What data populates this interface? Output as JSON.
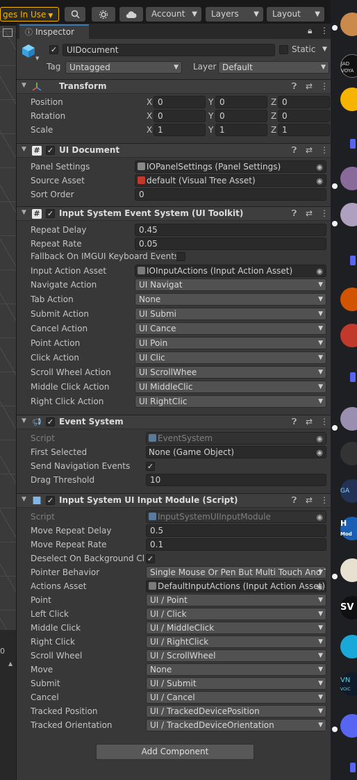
{
  "toolbar": {
    "changes_label": "ges In Use",
    "account_label": "Account",
    "layers_label": "Layers",
    "layout_label": "Layout",
    "icons": [
      "search-icon",
      "settings-gear-icon",
      "cloud-icon"
    ]
  },
  "scene": {
    "lower_label": "0"
  },
  "inspector": {
    "tab_label": "Inspector",
    "object": {
      "name": "UIDocument",
      "static_label": "Static",
      "tag_label": "Tag",
      "tag_value": "Untagged",
      "layer_label": "Layer",
      "layer_value": "Default"
    },
    "transform": {
      "title": "Transform",
      "rows": [
        {
          "label": "Position",
          "x": "0",
          "y": "0",
          "z": "0"
        },
        {
          "label": "Rotation",
          "x": "0",
          "y": "0",
          "z": "0"
        },
        {
          "label": "Scale",
          "x": "1",
          "y": "1",
          "z": "1"
        }
      ],
      "axes": [
        "X",
        "Y",
        "Z"
      ]
    },
    "ui_document": {
      "title": "UI Document",
      "panel_settings_label": "Panel Settings",
      "panel_settings_value": "IOPanelSettings (Panel Settings)",
      "source_asset_label": "Source Asset",
      "source_asset_value": "default (Visual Tree Asset)",
      "sort_order_label": "Sort Order",
      "sort_order_value": "0"
    },
    "input_event_system": {
      "title": "Input System Event System (UI Toolkit)",
      "repeat_delay_label": "Repeat Delay",
      "repeat_delay_value": "0.45",
      "repeat_rate_label": "Repeat Rate",
      "repeat_rate_value": "0.05",
      "fallback_label": "Fallback On IMGUI Keyboard Events",
      "input_action_asset_label": "Input Action Asset",
      "input_action_asset_value": "IOInputActions (Input Action Asset)",
      "actions": [
        {
          "label": "Navigate Action",
          "value": "UI Navigat"
        },
        {
          "label": "Tab Action",
          "value": "None"
        },
        {
          "label": "Submit Action",
          "value": "UI Submi"
        },
        {
          "label": "Cancel Action",
          "value": "UI Cance"
        },
        {
          "label": "Point Action",
          "value": "UI Poin"
        },
        {
          "label": "Click Action",
          "value": "UI Clic"
        },
        {
          "label": "Scroll Wheel Action",
          "value": "UI ScrollWhee"
        },
        {
          "label": "Middle Click Action",
          "value": "UI MiddleClic"
        },
        {
          "label": "Right Click Action",
          "value": "UI RightClic"
        }
      ]
    },
    "event_system": {
      "title": "Event System",
      "script_label": "Script",
      "script_value": "EventSystem",
      "first_selected_label": "First Selected",
      "first_selected_value": "None (Game Object)",
      "send_nav_label": "Send Navigation Events",
      "send_nav_checked": true,
      "drag_threshold_label": "Drag Threshold",
      "drag_threshold_value": "10"
    },
    "input_module": {
      "title": "Input System UI Input Module (Script)",
      "script_label": "Script",
      "script_value": "InputSystemUIInputModule",
      "move_repeat_delay_label": "Move Repeat Delay",
      "move_repeat_delay_value": "0.5",
      "move_repeat_rate_label": "Move Repeat Rate",
      "move_repeat_rate_value": "0.1",
      "deselect_label": "Deselect On Background Clic",
      "deselect_checked": true,
      "pointer_behavior_label": "Pointer Behavior",
      "pointer_behavior_value": "Single Mouse Or Pen But Multi Touch And T",
      "actions_asset_label": "Actions Asset",
      "actions_asset_value": "DefaultInputActions (Input Action Asset)",
      "actions": [
        {
          "label": "Point",
          "value": "UI / Point"
        },
        {
          "label": "Left Click",
          "value": "UI / Click"
        },
        {
          "label": "Middle Click",
          "value": "UI / MiddleClick"
        },
        {
          "label": "Right Click",
          "value": "UI / RightClick"
        },
        {
          "label": "Scroll Wheel",
          "value": "UI / ScrollWheel"
        },
        {
          "label": "Move",
          "value": "None"
        },
        {
          "label": "Submit",
          "value": "UI / Submit"
        },
        {
          "label": "Cancel",
          "value": "UI / Cancel"
        },
        {
          "label": "Tracked Position",
          "value": "UI / TrackedDevicePosition"
        },
        {
          "label": "Tracked Orientation",
          "value": "UI / TrackedDeviceOrientation"
        }
      ]
    },
    "add_component_label": "Add Component"
  },
  "right_strip": {
    "fragments": [
      "JAD",
      "VOYA",
      "GA",
      "H",
      "Mod",
      "SV",
      "VN",
      "VOIC"
    ],
    "colors": {
      "accent": "#5865f2",
      "server_bg": "#1e1f22"
    }
  },
  "colors": {
    "inspector_bg": "#383838",
    "header_bg": "#3e3e3e",
    "field_bg": "#2a2a2a",
    "dropdown_bg": "#515151",
    "changes_accent": "#f4b400",
    "tab_accent": "#3a79bb"
  }
}
